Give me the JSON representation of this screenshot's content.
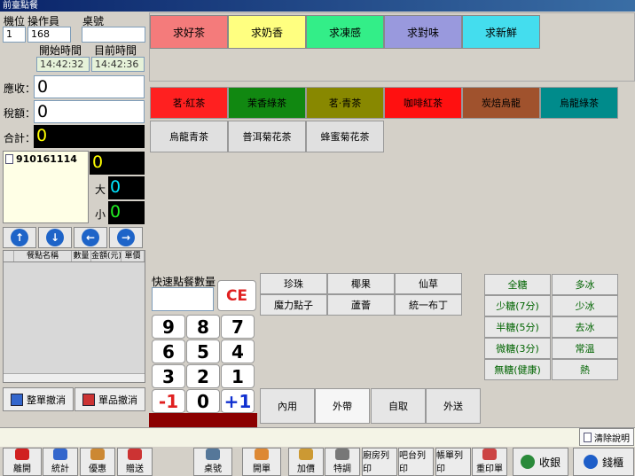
{
  "window": {
    "title": "前臺點餐"
  },
  "header": {
    "station_label": "機位",
    "operator_label": "操作員",
    "table_label": "桌號",
    "station_value": "1",
    "operator_value": "168",
    "table_value": "",
    "start_label": "開始時間",
    "now_label": "目前時間",
    "start_time": "14:42:32",
    "now_time": "14:42:36"
  },
  "amounts": {
    "receivable_label": "應收：",
    "receivable": "0",
    "tax_label": "稅額：",
    "tax": "0",
    "total_label": "合計：",
    "total": "0"
  },
  "customer": {
    "id": "910161114",
    "count": "0",
    "big_label": "大",
    "big": "0",
    "small_label": "小",
    "small": "0"
  },
  "order_table": {
    "headers": [
      "餐點名稱",
      "數量",
      "金額(元)",
      "單價"
    ]
  },
  "left_actions": {
    "clear_all": "整單撤消",
    "clear_item": "單品撤消"
  },
  "categories": [
    {
      "label": "求好茶",
      "color": "#f47b7b"
    },
    {
      "label": "求奶香",
      "color": "#ffff80"
    },
    {
      "label": "求凍感",
      "color": "#33ee88"
    },
    {
      "label": "求對味",
      "color": "#9999dd"
    },
    {
      "label": "求新鮮",
      "color": "#44ddee"
    }
  ],
  "products": [
    {
      "label": "茗‧紅茶",
      "color": "#ff2020",
      "text": "#000"
    },
    {
      "label": "茉香綠茶",
      "color": "#118811",
      "text": "#000"
    },
    {
      "label": "茗‧青茶",
      "color": "#888800",
      "text": "#000"
    },
    {
      "label": "咖啡紅茶",
      "color": "#ff1010",
      "text": "#000"
    },
    {
      "label": "炭焙烏龍",
      "color": "#a0522d",
      "text": "#000"
    },
    {
      "label": "烏龍綠茶",
      "color": "#008b8b",
      "text": "#000"
    },
    {
      "label": "烏龍青茶",
      "color": "#e0e0e0",
      "text": "#000"
    },
    {
      "label": "普洱菊花茶",
      "color": "#e0e0e0",
      "text": "#000"
    },
    {
      "label": "蜂蜜菊花茶",
      "color": "#e0e0e0",
      "text": "#000"
    }
  ],
  "keypad": {
    "label": "快速點餐數量",
    "ce": "CE",
    "keys": [
      "9",
      "8",
      "7",
      "6",
      "5",
      "4",
      "3",
      "2",
      "1",
      "-1",
      "0",
      "+1"
    ]
  },
  "toppings": [
    "珍珠",
    "椰果",
    "仙草",
    "魔力點子",
    "蘆薈",
    "統一布丁"
  ],
  "sugar_ice": [
    "全糖",
    "多冰",
    "少糖(7分)",
    "少冰",
    "半糖(5分)",
    "去冰",
    "微糖(3分)",
    "常溫",
    "無糖(健康)",
    "熱"
  ],
  "dining": [
    "內用",
    "外帶",
    "自取",
    "外送"
  ],
  "status": {
    "clear_help": "清除說明"
  },
  "footer": [
    "離開",
    "統計",
    "優惠",
    "贈送",
    "桌號",
    "開單",
    "加價",
    "特調",
    "廚房列印",
    "吧台列印",
    "帳單列印",
    "重印單",
    "收銀",
    "錢櫃"
  ]
}
